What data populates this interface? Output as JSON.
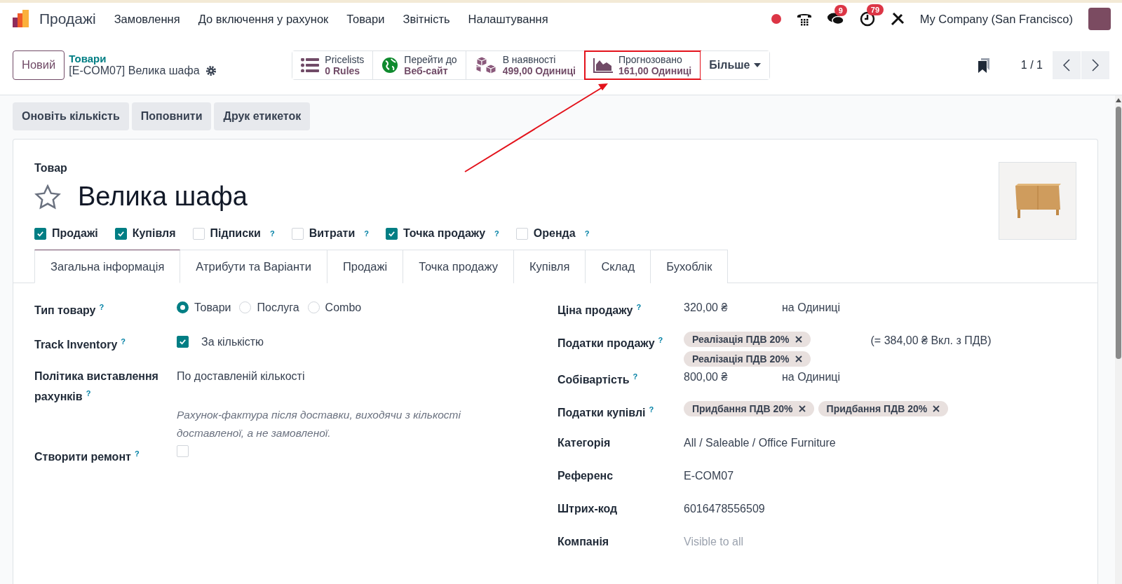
{
  "navbar": {
    "app_name": "Продажі",
    "menu": [
      "Замовлення",
      "До включення у рахунок",
      "Товари",
      "Звітність",
      "Налаштування"
    ],
    "messages_badge": "9",
    "activities_badge": "79",
    "company": "My Company (San Francisco)"
  },
  "control_panel": {
    "new_button": "Новий",
    "breadcrumb": "Товари",
    "record_title": "[E-COM07] Велика шафа",
    "smart_buttons": [
      {
        "kind": "list",
        "title": "Pricelists",
        "value": "0 Rules",
        "highlighted": false
      },
      {
        "kind": "globe",
        "title": "Перейти до",
        "value": "Веб-сайт",
        "highlighted": false
      },
      {
        "kind": "boxes",
        "title": "В наявності",
        "value": "499,00 Одиниці",
        "highlighted": false
      },
      {
        "kind": "chart",
        "title": "Прогнозовано",
        "value": "161,00 Одиниці",
        "highlighted": true
      }
    ],
    "more_button": "Більше",
    "pager": "1 / 1"
  },
  "action_buttons": [
    "Оновіть кількість",
    "Поповнити",
    "Друк етикеток"
  ],
  "form": {
    "label": "Товар",
    "name": "Велика шафа",
    "favorite": false,
    "options": [
      {
        "label": "Продажі",
        "checked": true
      },
      {
        "label": "Купівля",
        "checked": true
      },
      {
        "label": "Підписки",
        "checked": false,
        "help": "?"
      },
      {
        "label": "Витрати",
        "checked": false,
        "help": "?"
      },
      {
        "label": "Точка продажу",
        "checked": true,
        "help": "?"
      },
      {
        "label": "Оренда",
        "checked": false,
        "help": "?"
      }
    ],
    "tabs": [
      {
        "label": "Загальна інформація",
        "selected": true
      },
      {
        "label": "Атрибути та Варіанти",
        "selected": false
      },
      {
        "label": "Продажі",
        "selected": false
      },
      {
        "label": "Точка продажу",
        "selected": false
      },
      {
        "label": "Купівля",
        "selected": false
      },
      {
        "label": "Склад",
        "selected": false
      },
      {
        "label": "Бухоблік",
        "selected": false
      }
    ],
    "left_fields": [
      {
        "kind": "radio",
        "label": "Тип товару",
        "help": "?",
        "options": [
          {
            "label": "Товари",
            "selected": true
          },
          {
            "label": "Послуга",
            "selected": false
          },
          {
            "label": "Combo",
            "selected": false
          }
        ]
      },
      {
        "kind": "checkbox",
        "label": "Track Inventory",
        "help": "?",
        "checked": true,
        "text": "За кількістю"
      },
      {
        "kind": "text",
        "label": "Політика виставлення рахунків",
        "help": "?",
        "value": "По доставленій кількості",
        "note": "Рахунок-фактура після доставки, виходячи з кількості доставленої, а не замовленої."
      },
      {
        "kind": "checkbox",
        "label": "Створити ремонт",
        "help": "?",
        "checked": false
      }
    ],
    "right_fields": [
      {
        "kind": "money",
        "label": "Ціна продажу",
        "help": "?",
        "value": "320,00 ₴",
        "unit": "на Одиниці"
      },
      {
        "kind": "tags",
        "label": "Податки продажу",
        "help": "?",
        "tags": [
          "Реалізація ПДВ 20%",
          "Реалізація ПДВ 20%"
        ],
        "extra": "(= 384,00 ₴ Вкл. з ПДВ)",
        "stacked": true
      },
      {
        "kind": "money",
        "label": "Собівартість",
        "help": "?",
        "value": "800,00 ₴",
        "unit": "на Одиниці"
      },
      {
        "kind": "tags",
        "label": "Податки купівлі",
        "help": "?",
        "tags": [
          "Придбання ПДВ 20%",
          "Придбання ПДВ 20%"
        ],
        "stacked": false
      },
      {
        "kind": "text",
        "label": "Категорія",
        "value": "All / Saleable / Office Furniture"
      },
      {
        "kind": "text",
        "label": "Референс",
        "value": "E-COM07"
      },
      {
        "kind": "text",
        "label": "Штрих-код",
        "value": "6016478556509"
      },
      {
        "kind": "muted",
        "label": "Компанія",
        "placeholder": "Visible to all"
      }
    ]
  }
}
